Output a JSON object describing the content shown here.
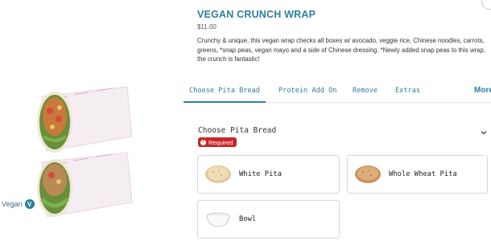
{
  "product": {
    "title": "VEGAN CRUNCH WRAP",
    "price": "$11.00",
    "description": "Crunchy & unique, this vegan wrap checks all boxes w/ avocado, veggie rice, Chinese noodles, carrots, greens, *snap peas, vegan mayo and a side of Chinese dressing. *Newly added snap peas to this wrap, the crunch is fantastic!"
  },
  "tag": {
    "label": "Vegan",
    "badge": "V"
  },
  "tabs": [
    {
      "label": "Choose Pita Bread",
      "active": true
    },
    {
      "label": "Protein Add On",
      "active": false
    },
    {
      "label": "Remove",
      "active": false
    },
    {
      "label": "Extras",
      "active": false
    },
    {
      "label": "More",
      "active": false
    }
  ],
  "section": {
    "title": "Choose Pita Bread",
    "required_label": "Required",
    "required_icon": "!"
  },
  "options": [
    {
      "label": "White Pita",
      "icon": "white-pita-icon"
    },
    {
      "label": "Whole Wheat Pita",
      "icon": "whole-wheat-pita-icon"
    },
    {
      "label": "Bowl",
      "icon": "bowl-icon"
    }
  ],
  "colors": {
    "accent": "#2f7f9e",
    "required": "#c62828"
  }
}
